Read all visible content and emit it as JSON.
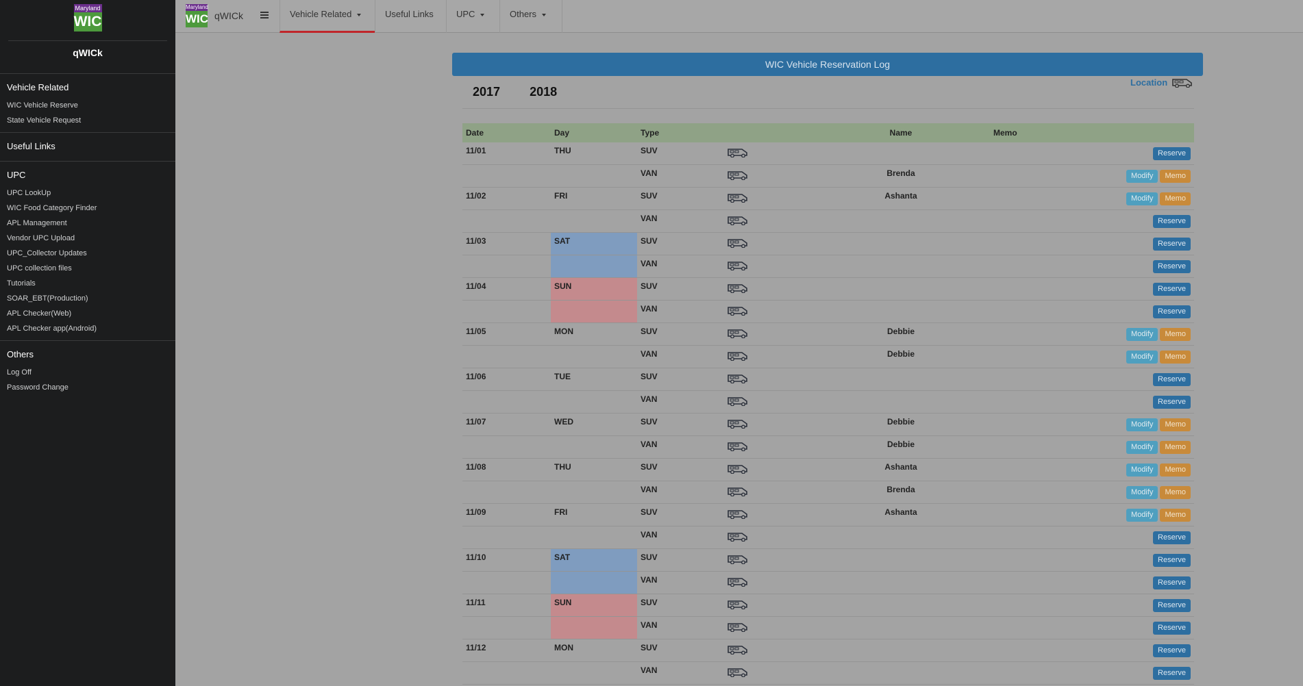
{
  "sidebar": {
    "logo_top": "Maryland",
    "logo_main": "WIC",
    "brand": "qWICk",
    "sections": [
      {
        "title": "Vehicle Related",
        "items": [
          "WIC Vehicle Reserve",
          "State Vehicle Request"
        ]
      },
      {
        "title": "Useful Links",
        "items": []
      },
      {
        "title": "UPC",
        "items": [
          "UPC LookUp",
          "WIC Food Category Finder",
          "APL Management",
          "Vendor UPC Upload",
          "UPC_Collector Updates",
          "UPC collection files",
          "Tutorials",
          "SOAR_EBT(Production)",
          "APL Checker(Web)",
          "APL Checker app(Android)"
        ]
      },
      {
        "title": "Others",
        "items": [
          "Log Off",
          "Password Change"
        ]
      }
    ]
  },
  "topbar": {
    "logo_top": "Maryland",
    "logo_main": "WIC",
    "brand": "qWICk",
    "menu_icon": "hamburger-icon",
    "nav": [
      "Vehicle Related",
      "Useful Links",
      "UPC",
      "Others"
    ]
  },
  "panel": {
    "title": "WIC Vehicle Reservation Log",
    "years": [
      "2017",
      "2018"
    ],
    "location_label": "Location",
    "location_icon": "van-icon"
  },
  "table": {
    "headers": {
      "date": "Date",
      "day": "Day",
      "type": "Type",
      "name": "Name",
      "memo": "Memo"
    },
    "buttons": {
      "reserve": "Reserve",
      "modify": "Modify",
      "memo": "Memo"
    },
    "rows": [
      {
        "date": "11/01",
        "day": "THU",
        "type": "SUV",
        "name": "",
        "weekend": ""
      },
      {
        "date": "",
        "day": "",
        "type": "VAN",
        "name": "Brenda",
        "weekend": ""
      },
      {
        "date": "11/02",
        "day": "FRI",
        "type": "SUV",
        "name": "Ashanta",
        "weekend": ""
      },
      {
        "date": "",
        "day": "",
        "type": "VAN",
        "name": "",
        "weekend": ""
      },
      {
        "date": "11/03",
        "day": "SAT",
        "type": "SUV",
        "name": "",
        "weekend": "sat"
      },
      {
        "date": "",
        "day": "",
        "type": "VAN",
        "name": "",
        "weekend": "sat"
      },
      {
        "date": "11/04",
        "day": "SUN",
        "type": "SUV",
        "name": "",
        "weekend": "sun"
      },
      {
        "date": "",
        "day": "",
        "type": "VAN",
        "name": "",
        "weekend": "sun"
      },
      {
        "date": "11/05",
        "day": "MON",
        "type": "SUV",
        "name": "Debbie",
        "weekend": ""
      },
      {
        "date": "",
        "day": "",
        "type": "VAN",
        "name": "Debbie",
        "weekend": ""
      },
      {
        "date": "11/06",
        "day": "TUE",
        "type": "SUV",
        "name": "",
        "weekend": ""
      },
      {
        "date": "",
        "day": "",
        "type": "VAN",
        "name": "",
        "weekend": ""
      },
      {
        "date": "11/07",
        "day": "WED",
        "type": "SUV",
        "name": "Debbie",
        "weekend": ""
      },
      {
        "date": "",
        "day": "",
        "type": "VAN",
        "name": "Debbie",
        "weekend": ""
      },
      {
        "date": "11/08",
        "day": "THU",
        "type": "SUV",
        "name": "Ashanta",
        "weekend": ""
      },
      {
        "date": "",
        "day": "",
        "type": "VAN",
        "name": "Brenda",
        "weekend": ""
      },
      {
        "date": "11/09",
        "day": "FRI",
        "type": "SUV",
        "name": "Ashanta",
        "weekend": ""
      },
      {
        "date": "",
        "day": "",
        "type": "VAN",
        "name": "",
        "weekend": ""
      },
      {
        "date": "11/10",
        "day": "SAT",
        "type": "SUV",
        "name": "",
        "weekend": "sat"
      },
      {
        "date": "",
        "day": "",
        "type": "VAN",
        "name": "",
        "weekend": "sat"
      },
      {
        "date": "11/11",
        "day": "SUN",
        "type": "SUV",
        "name": "",
        "weekend": "sun"
      },
      {
        "date": "",
        "day": "",
        "type": "VAN",
        "name": "",
        "weekend": "sun"
      },
      {
        "date": "11/12",
        "day": "MON",
        "type": "SUV",
        "name": "",
        "weekend": ""
      },
      {
        "date": "",
        "day": "",
        "type": "VAN",
        "name": "",
        "weekend": ""
      }
    ]
  },
  "colors": {
    "header_blue": "#2d6ea0",
    "table_head_green": "#8fa286",
    "saturday": "#7f9cbf",
    "sunday": "#c48a8d",
    "active_tab": "#c0262a"
  }
}
